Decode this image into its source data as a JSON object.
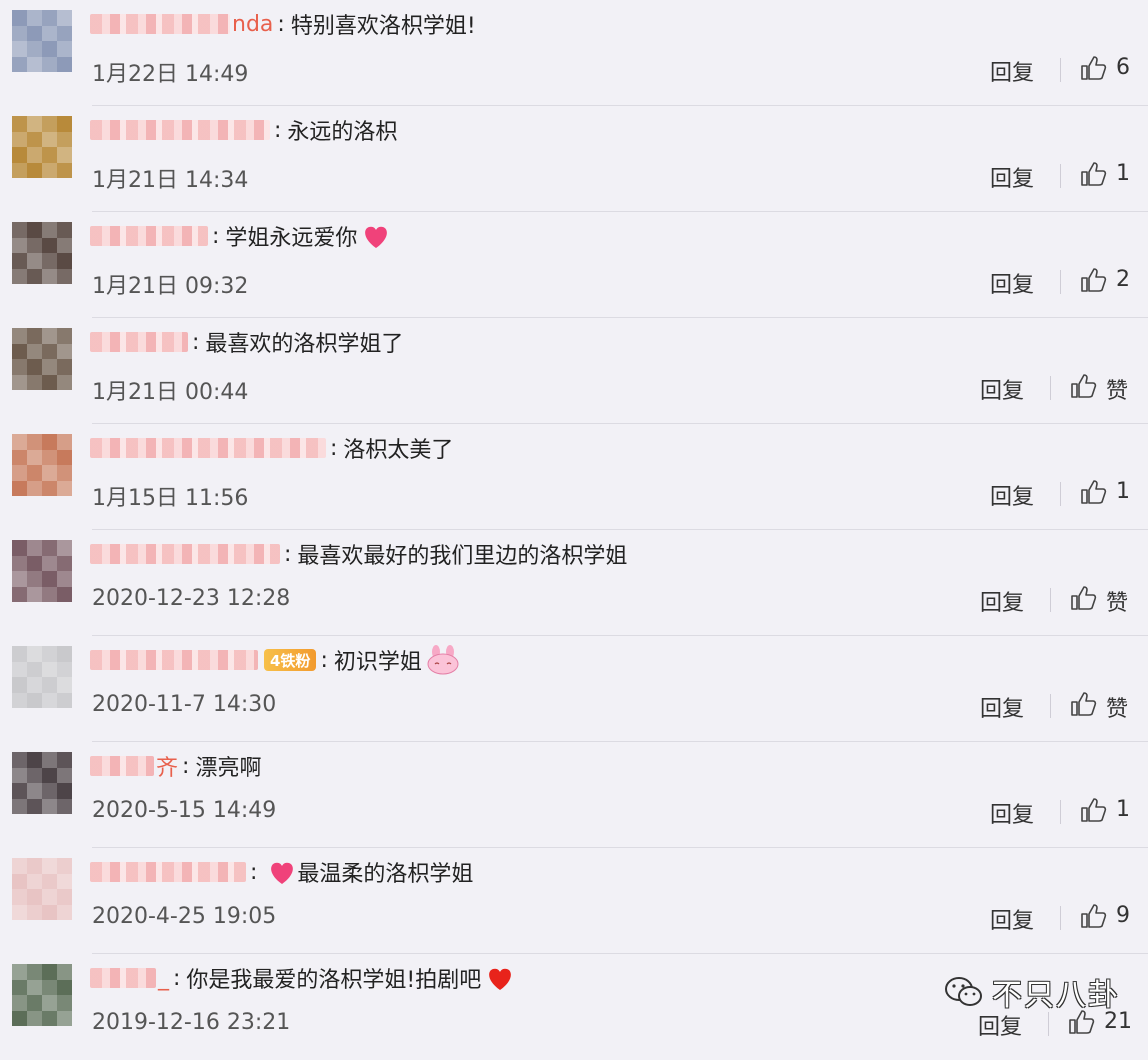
{
  "comments": [
    {
      "name_tail": "nda",
      "text": "特别喜欢洛枳学姐!",
      "time": "1月22日 14:49",
      "reply": "回复",
      "likes": "6",
      "emoji": "",
      "avatar": "#8d9ab8"
    },
    {
      "name_tail": "",
      "text": "永远的洛枳",
      "time": "1月21日 14:34",
      "reply": "回复",
      "likes": "1",
      "emoji": "",
      "avatar": "#b88a3a"
    },
    {
      "name_tail": "",
      "text": "学姐永远爱你",
      "time": "1月21日 09:32",
      "reply": "回复",
      "likes": "2",
      "emoji": "heart",
      "avatar": "#5a4a44"
    },
    {
      "name_tail": "",
      "text": "最喜欢的洛枳学姐了",
      "time": "1月21日 00:44",
      "reply": "回复",
      "likes": "赞",
      "emoji": "",
      "avatar": "#6d5c4e"
    },
    {
      "name_tail": "",
      "text": "洛枳太美了",
      "time": "1月15日 11:56",
      "reply": "回复",
      "likes": "1",
      "emoji": "",
      "avatar": "#c77a5c"
    },
    {
      "name_tail": "",
      "text": "最喜欢最好的我们里边的洛枳学姐",
      "time": "2020-12-23 12:28",
      "reply": "回复",
      "likes": "赞",
      "emoji": "",
      "avatar": "#7a5d66"
    },
    {
      "name_tail": "",
      "badge": "4铁粉",
      "text": "初识学姐",
      "time": "2020-11-7 14:30",
      "reply": "回复",
      "likes": "赞",
      "emoji": "bunny",
      "avatar": "#c9c9cc"
    },
    {
      "name_tail": "齐",
      "text": "漂亮啊",
      "time": "2020-5-15 14:49",
      "reply": "回复",
      "likes": "1",
      "emoji": "",
      "avatar": "#4d4448"
    },
    {
      "name_tail": "",
      "text": "最温柔的洛枳学姐",
      "time": "2020-4-25 19:05",
      "reply": "回复",
      "likes": "9",
      "emoji": "heart-front",
      "avatar": "#e8c4c4"
    },
    {
      "name_tail": "_",
      "text": "你是我最爱的洛枳学姐!拍剧吧",
      "time": "2019-12-16 23:21",
      "reply": "回复",
      "likes": "21",
      "emoji": "red-heart",
      "avatar": "#5c6e58"
    }
  ],
  "watermark": {
    "text": "不只八卦",
    "icon": "wechat-icon"
  },
  "colors": {
    "background": "#f2f1f6",
    "name_accent": "#e8604c"
  }
}
